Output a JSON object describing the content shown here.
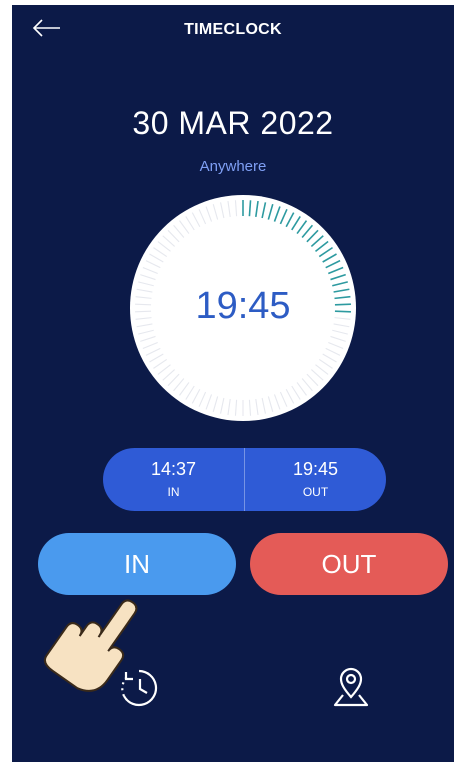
{
  "header": {
    "title": "TIMECLOCK",
    "back_icon": "arrow-left-icon"
  },
  "date": "30 MAR 2022",
  "location": "Anywhere",
  "clock": {
    "time": "19:45",
    "accent_color": "#2d9aa0"
  },
  "shift": {
    "in_time": "14:37",
    "in_label": "IN",
    "out_time": "19:45",
    "out_label": "OUT"
  },
  "actions": {
    "in_label": "IN",
    "out_label": "OUT",
    "in_color": "#4a9aee",
    "out_color": "#e45b57"
  },
  "bottom_nav": {
    "history_icon": "clock-history-icon",
    "location_icon": "map-pin-icon"
  },
  "colors": {
    "background": "#0c1a48",
    "pill": "#2f5bd6"
  }
}
